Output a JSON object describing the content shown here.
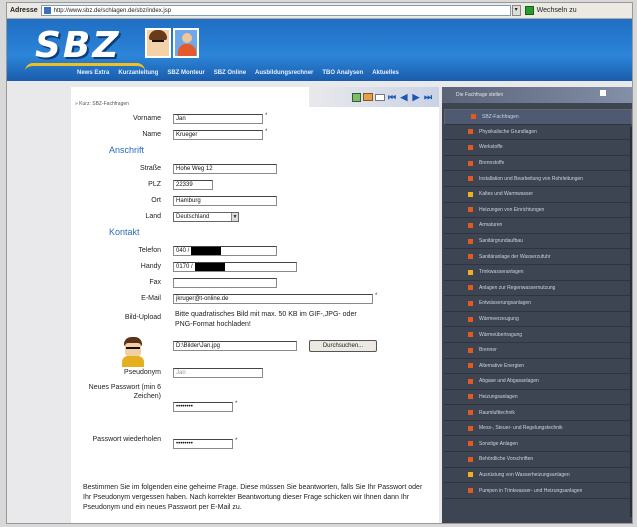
{
  "browser": {
    "address_label": "Adresse",
    "url": "http://www.sbz.de/schlagen.de/sbz/index.jsp",
    "go_label": "Wechseln zu"
  },
  "header": {
    "logo_text": "SBZ",
    "nav": [
      "News Extra",
      "Kurzanleitung",
      "SBZ Monteur",
      "SBZ Online",
      "Ausbildungsrechner",
      "TBO Analysen",
      "Aktuelles"
    ]
  },
  "breadcrumb": "» Kurz: SBZ-Fachfragen",
  "form": {
    "vorname": {
      "label": "Vorname",
      "value": "Jan"
    },
    "name": {
      "label": "Name",
      "value": "Krueger"
    },
    "section_anschrift": "Anschrift",
    "strasse": {
      "label": "Straße",
      "value": "Hohe Weg 12"
    },
    "plz": {
      "label": "PLZ",
      "value": "22339"
    },
    "ort": {
      "label": "Ort",
      "value": "Hamburg"
    },
    "land": {
      "label": "Land",
      "value": "Deutschland"
    },
    "section_kontakt": "Kontakt",
    "telefon": {
      "label": "Telefon",
      "value": "040 /"
    },
    "handy": {
      "label": "Handy",
      "value": "0170 /"
    },
    "fax": {
      "label": "Fax",
      "value": ""
    },
    "email": {
      "label": "E-Mail",
      "value": "jkruger@t-online.de"
    },
    "upload": {
      "label": "Bild-Upload",
      "note": "Bitte quadratisches Bild mit max. 50 KB im GIF-,JPG- oder PNG-Format hochladen!",
      "file_value": "D:\\Bilder\\Jan.jpg",
      "browse_label": "Durchsuchen..."
    },
    "pseudonym": {
      "label": "Pseudonym",
      "placeholder": "Jan"
    },
    "new_password": {
      "label": "Neues Passwort (min 6 Zeichen)",
      "value": "••••••••"
    },
    "repeat_password": {
      "label": "Passwort wiederholen",
      "value": "••••••••"
    },
    "secret_question_text": "Bestimmen Sie im folgenden eine geheime Frage. Diese müssen Sie beantworten, falls Sie Ihr Passwort oder Ihr Pseudonym vergessen haben. Nach korrekter Beantwortung dieser Frage schicken wir Ihnen dann Ihr Pseudonym und ein neues Passwort per E-Mail zu."
  },
  "sidebar": {
    "title": "Die Fachfrage stellen",
    "items": [
      "SBZ-Fachfragen",
      "Physikalische Grundlagen",
      "Werkstoffe",
      "Brennstoffe",
      "Installation und Bearbeitung von Rohrleitungen",
      "Kaltes und Warmwasser",
      "Heizungen von Einrichtungen",
      "Armaturen",
      "Sanitärgrundaufbau",
      "Sanitäranlage der Wasserzufuhr",
      "Trinkwasseranlagen",
      "Anlagen zur Regenwassernutzung",
      "Entwässerungsanlagen",
      "Wärmeerzeugung",
      "Wärmeübertragung",
      "Brenner",
      "Alternative Energien",
      "Abgase und Abgasanlagen",
      "Heizungsanlagen",
      "Raumlufttechnik",
      "Mess-, Steuer- und Regelungstechnik",
      "Sonstige Anlagen",
      "Behördliche Vorschriften",
      "Ausrüstung von Wasserheizungsanlagen",
      "Pumpen in Trinkwasser- und Heizungsanlagen"
    ]
  },
  "colors": {
    "header_blue": "#1f6ec4",
    "section_blue": "#2a6bbd",
    "sidebar_bg": "#3d4452",
    "bullet_orange": "#e25a1f"
  }
}
